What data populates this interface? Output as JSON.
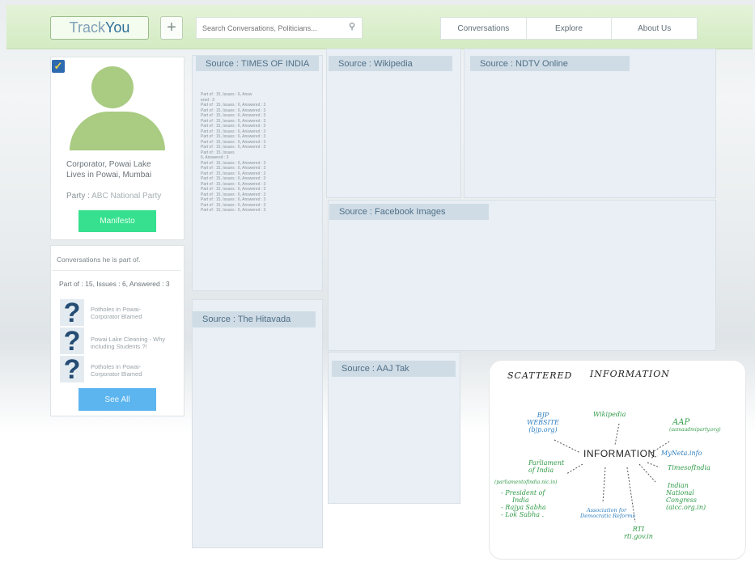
{
  "header": {
    "logo_pre": "Track",
    "logo_post": "You",
    "plus": "+",
    "search_placeholder": "Search Conversations, Politicians...",
    "search_icon": "search-icon",
    "nav": [
      "Conversations",
      "Explore",
      "About Us"
    ]
  },
  "profile": {
    "check": "✓",
    "desc_line1": "Corporator, Powai Lake",
    "desc_line2": "Lives in Powai, Mumbai",
    "party_label": "Party :",
    "party_value": "ABC National Party",
    "manifesto_label": "Manifesto"
  },
  "conversations": {
    "title": "Conversations he is part of.",
    "stats": "Part of : 15, Issues : 6, Answered : 3",
    "items": [
      {
        "icon": "?",
        "text1": "Potholes in Powai-",
        "text2": "Corporator Blamed"
      },
      {
        "icon": "?",
        "text1": "Powai Lake Cleaning - Why",
        "text2": "including Students ?!"
      },
      {
        "icon": "?",
        "text1": "Potholes in Powai-",
        "text2": "Corporator Blamed"
      }
    ],
    "see_all": "See All"
  },
  "sources": {
    "times": "Source : TIMES OF INDIA",
    "wiki": "Source : Wikipedia",
    "ndtv": "Source : NDTV Online",
    "facebook": "Source : Facebook Images",
    "hitavada": "Source : The Hitavada",
    "aajtak": "Source : AAJ Tak"
  },
  "times_lines": [
    "Part of : 15, Issues : 6, Answ",
    "ered : 3",
    "Part of : 15, Issues : 6, Answered : 3",
    "Part of : 15, Issues : 6, Answered : 3",
    "Part of : 15, Issues : 6, Answered : 3",
    "Part of : 15, Issues : 6, Answered : 3",
    "Part of : 15, Issues : 6, Answered : 3",
    "Part of : 15, Issues : 6, Answered : 3",
    "Part of : 15, Issues : 6, Answered : 3",
    "Part of : 15, Issues : 6, Answered : 3",
    "Part of : 15, Issues : 6, Answered : 3",
    "Part of : 15, Issues",
    "6, Answered : 3",
    "Part of : 15, Issues : 6, Answered : 3",
    "Part of : 15, Issues : 6, Answered : 3",
    "Part of : 15, Issues : 6, Answered : 3",
    "Part of : 15, Issues : 6, Answered : 3",
    "Part of : 15, Issues : 6, Answered : 3",
    "Part of : 15, Issues : 6, Answered : 3",
    "Part of : 15, Issues : 6, Answered : 3",
    "Part of : 15, Issues : 6, Answered : 3",
    "Part of : 15, Issues : 6, Answered : 3",
    "Part of : 15, Issues : 6, Answered : 3"
  ],
  "scattered": {
    "title_a": "SCATTERED",
    "title_b": "INFORMATION",
    "center": "INFORMATION",
    "bjp": [
      "BJP",
      "WEBSITE",
      "(bjp.org)"
    ],
    "wikipedia": "Wikipedia",
    "aap": [
      "AAP",
      "(aamaadmiparty.org)"
    ],
    "mynota": "MyNeta.info",
    "toi": "TimesofIndia",
    "parliament": [
      "Parliament",
      "of India",
      "(parliamentofindia.nic.in)"
    ],
    "parl_items": [
      "- President of",
      "India",
      "- Rajya Sabha",
      "- Lok Sabha ."
    ],
    "inc": [
      "Indian",
      "National",
      "Congress",
      "(aicc.org.in)"
    ],
    "adr": [
      "Association for",
      "Democratic Reforms"
    ],
    "rti": [
      "RTI",
      "rti.gov.in"
    ]
  }
}
